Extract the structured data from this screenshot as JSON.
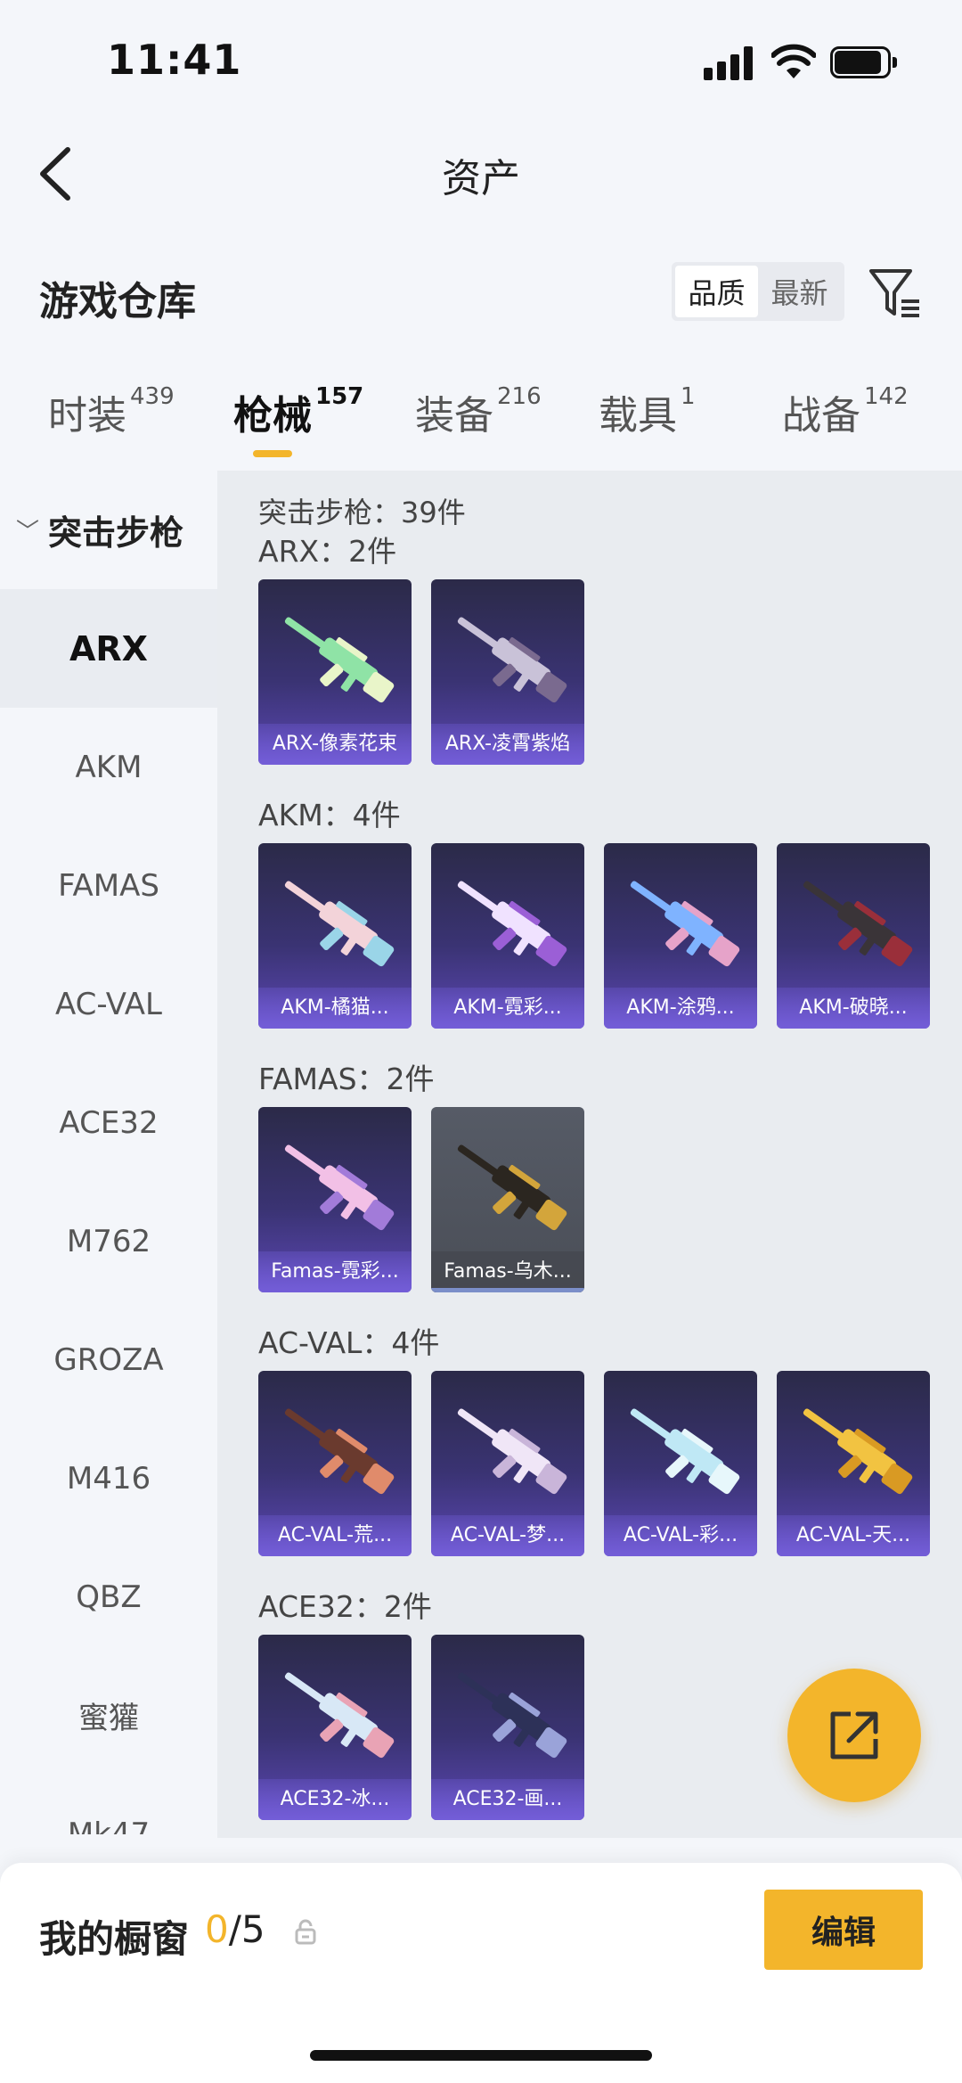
{
  "status_bar": {
    "time": "11:41"
  },
  "header": {
    "title": "资产"
  },
  "warehouse": {
    "title": "游戏仓库",
    "sort_options": [
      {
        "label": "品质",
        "active": true
      },
      {
        "label": "最新",
        "active": false
      }
    ]
  },
  "tabs": [
    {
      "label": "时装",
      "count": "439"
    },
    {
      "label": "枪械",
      "count": "157",
      "active": true
    },
    {
      "label": "装备",
      "count": "216"
    },
    {
      "label": "载具",
      "count": "1"
    },
    {
      "label": "战备",
      "count": "142"
    }
  ],
  "sidebar": {
    "category": "突击步枪",
    "items": [
      "ARX",
      "AKM",
      "FAMAS",
      "AC-VAL",
      "ACE32",
      "M762",
      "GROZA",
      "M416",
      "QBZ",
      "蜜獾",
      "Mk47"
    ],
    "active_item": "ARX"
  },
  "content": {
    "summary": "突击步枪：39件",
    "groups": [
      {
        "label": "ARX：2件",
        "items": [
          "ARX-像素花束",
          "ARX-凌霄紫焰"
        ]
      },
      {
        "label": "AKM：4件",
        "items": [
          "AKM-橘猫...",
          "AKM-霓彩...",
          "AKM-涂鸦...",
          "AKM-破晓..."
        ]
      },
      {
        "label": "FAMAS：2件",
        "items": [
          "Famas-霓彩...",
          "Famas-乌木..."
        ]
      },
      {
        "label": "AC-VAL：4件",
        "items": [
          "AC-VAL-荒...",
          "AC-VAL-梦...",
          "AC-VAL-彩...",
          "AC-VAL-天..."
        ]
      },
      {
        "label": "ACE32：2件",
        "items": [
          "ACE32-冰...",
          "ACE32-画..."
        ]
      }
    ]
  },
  "bottom_bar": {
    "showcase_label": "我的橱窗",
    "showcase_current": "0",
    "showcase_total": "/5",
    "edit_label": "编辑"
  },
  "colors": {
    "accent": "#f3b52b",
    "card_purple": "#5b47b3"
  }
}
